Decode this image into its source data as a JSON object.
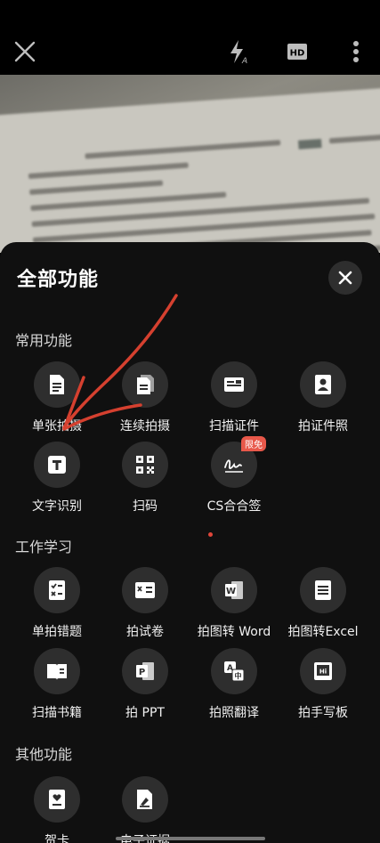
{
  "sheet": {
    "title": "全部功能",
    "badge": "限免"
  },
  "sections": {
    "common": {
      "title": "常用功能",
      "items": [
        "单张拍摄",
        "连续拍摄",
        "扫描证件",
        "拍证件照",
        "文字识别",
        "扫码",
        "CS合合签"
      ]
    },
    "work": {
      "title": "工作学习",
      "items": [
        "单拍错题",
        "拍试卷",
        "拍图转 Word",
        "拍图转Excel",
        "扫描书籍",
        "拍 PPT",
        "拍照翻译",
        "拍手写板"
      ]
    },
    "other": {
      "title": "其他功能",
      "items": [
        "贺卡",
        "电子证据"
      ]
    }
  },
  "icons": {
    "close": "close-icon",
    "flash": "flash-auto-icon",
    "hd": "hd-icon",
    "more": "more-vertical-icon"
  },
  "colors": {
    "accent_red": "#e8584a",
    "sheet_bg": "#101010",
    "circle_bg": "#2e2e2e"
  }
}
